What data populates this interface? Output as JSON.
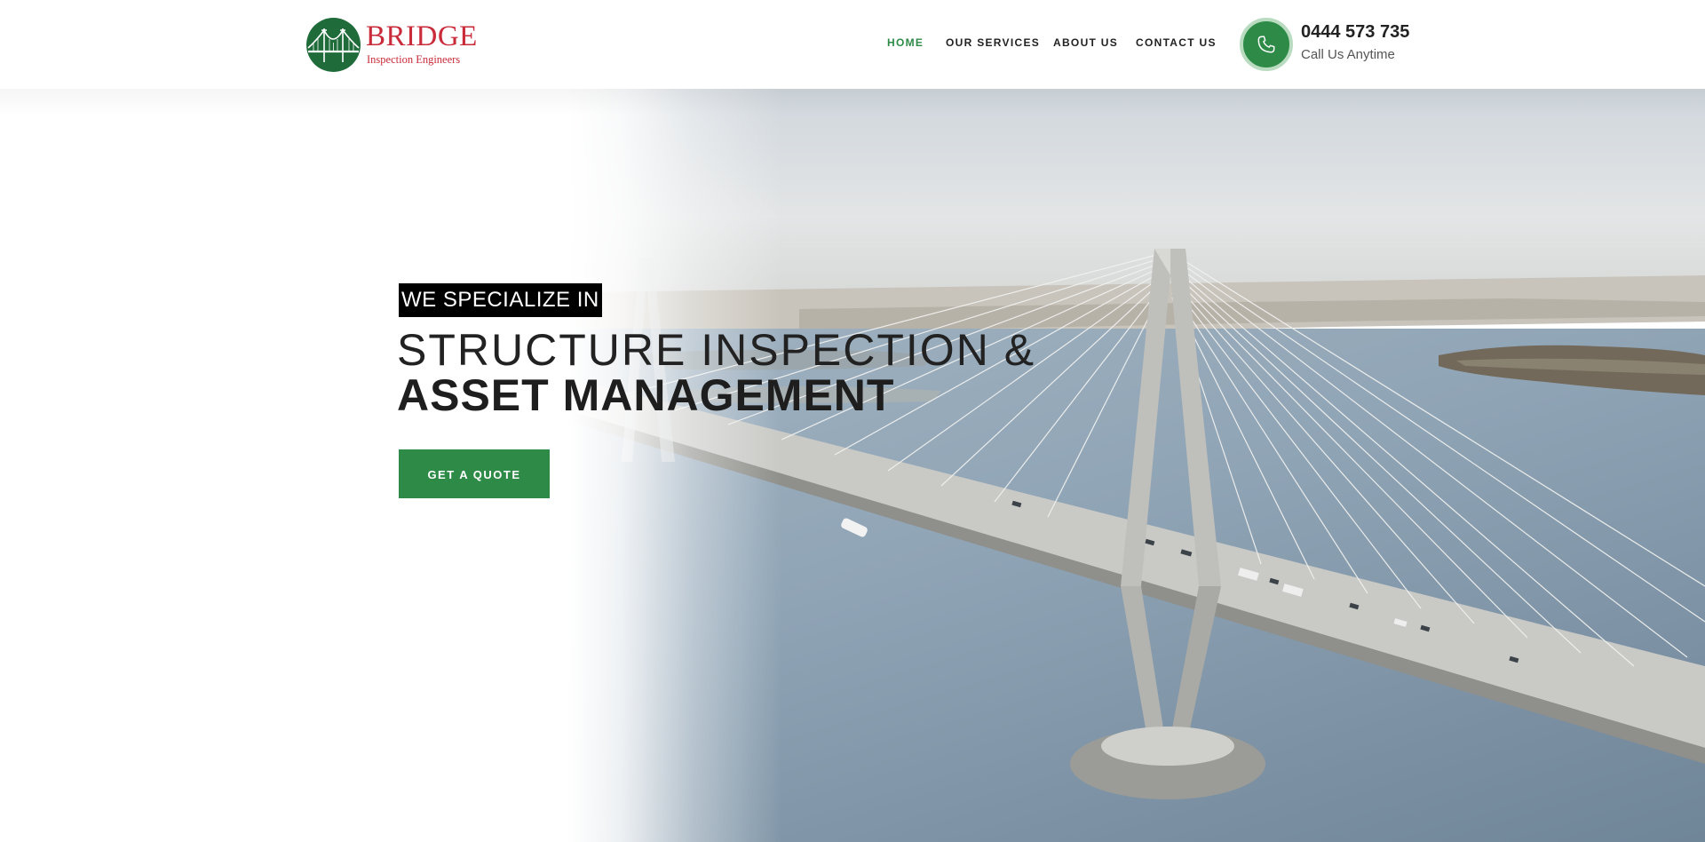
{
  "brand": {
    "name": "BRIDGE",
    "subtitle": "Inspection Engineers",
    "icon": "bridge-logo-icon",
    "colors": {
      "primary": "#2e8b47",
      "logo_red": "#c92b3a",
      "logo_green": "#1f6b3a"
    }
  },
  "nav": {
    "items": [
      {
        "label": "HOME",
        "active": true
      },
      {
        "label": "OUR SERVICES",
        "active": false
      },
      {
        "label": "ABOUT US",
        "active": false
      },
      {
        "label": "CONTACT US",
        "active": false
      }
    ]
  },
  "contact": {
    "icon": "phone-icon",
    "number": "0444 573 735",
    "caption": "Call Us Anytime"
  },
  "hero": {
    "tag": "WE SPECIALIZE IN",
    "headline_line1": "STRUCTURE INSPECTION &",
    "headline_line2": "ASSET MANAGEMENT",
    "cta_label": "GET A QUOTE",
    "background": "cable-stayed bridge over water, aerial view"
  }
}
